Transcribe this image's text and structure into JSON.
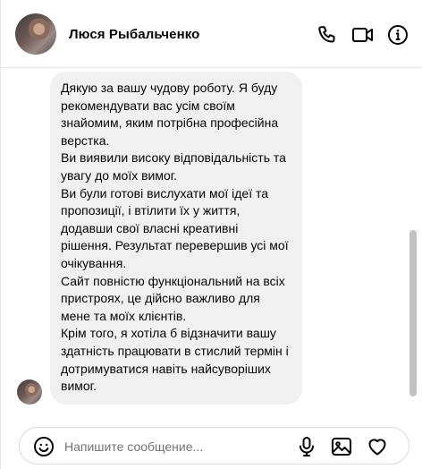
{
  "header": {
    "contact_name": "Люся Рыбальченко",
    "icons": [
      "phone-icon",
      "video-camera-icon",
      "info-icon"
    ]
  },
  "messages": [
    {
      "sender": "contact",
      "text": "Дякую за вашу чудову роботу. Я буду рекомендувати вас усім своїм знайомим, яким потрібна професійна верстка.\nВи виявили високу відповідальність та увагу до моїх вимог.\nВи були готові вислухати мої ідеї та пропозиції, і втілити їх у життя, додавши свої власні креативні рішення. Результат перевершив усі мої очікування.\nСайт повністю функціональний на всіх пристроях, це дійсно важливо для мене та моїх клієнтів.\nКрім того, я хотіла б відзначити вашу здатність працювати в стислий термін і дотримуватися навіть найсуворіших вимог."
    }
  ],
  "composer": {
    "placeholder": "Напишите сообщение...",
    "value": "",
    "icons": [
      "emoji-icon",
      "microphone-icon",
      "image-icon",
      "heart-icon"
    ]
  },
  "colors": {
    "bubble_bg": "#f0f0f0",
    "border": "#e4e6eb",
    "icon": "#050505",
    "placeholder": "#737373"
  }
}
